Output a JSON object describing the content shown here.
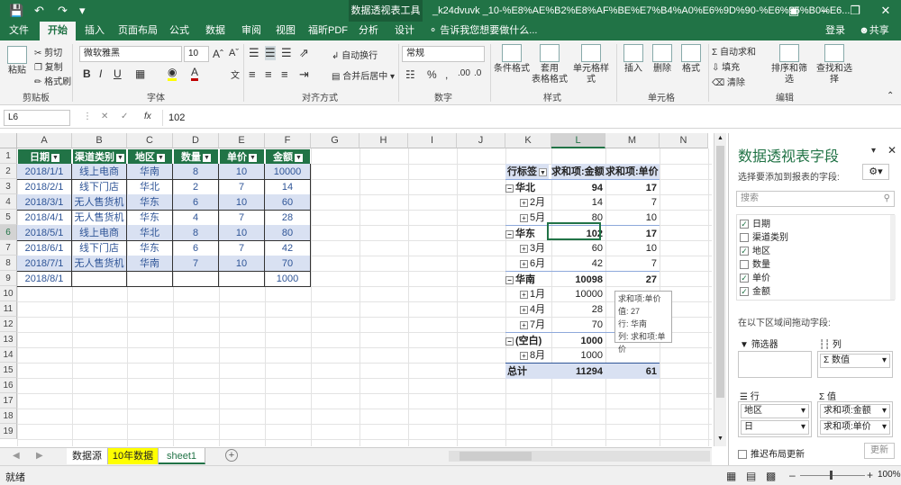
{
  "titlebar": {
    "context_tool": "数据透视表工具",
    "doc_name": "_k24dvuvk _10-%E8%AE%B2%E8%AF%BE%E7%B4%A0%E6%9D%90-%E6%95%B0%E6..."
  },
  "tabs": [
    "文件",
    "开始",
    "插入",
    "页面布局",
    "公式",
    "数据",
    "审阅",
    "视图",
    "福昕PDF",
    "分析",
    "设计"
  ],
  "tell_me": "告诉我您想要做什么...",
  "login": "登录",
  "share": "共享",
  "ribbon": {
    "paste": "粘贴",
    "cut": "剪切",
    "copy": "复制",
    "format_painter": "格式刷",
    "clipboard_label": "剪贴板",
    "font_name": "微软雅黑",
    "font_size": "10",
    "font_label": "字体",
    "wrap": "自动换行",
    "merge": "合并后居中",
    "align_label": "对齐方式",
    "number_format": "常规",
    "number_label": "数字",
    "cond_format": "条件格式",
    "table_format": "套用\n表格格式",
    "cell_style": "单元格样式",
    "style_label": "样式",
    "insert": "插入",
    "delete": "删除",
    "format": "格式",
    "cells_label": "单元格",
    "autosum": "自动求和",
    "fill": "填充",
    "clear": "清除",
    "sort_filter": "排序和筛选",
    "find_select": "查找和选择",
    "edit_label": "编辑"
  },
  "formula_bar": {
    "name_box": "L6",
    "value": "102"
  },
  "columns": [
    "A",
    "B",
    "C",
    "D",
    "E",
    "F",
    "G",
    "H",
    "I",
    "J",
    "K",
    "L",
    "M",
    "N"
  ],
  "rows": [
    "1",
    "2",
    "3",
    "4",
    "5",
    "6",
    "7",
    "8",
    "9",
    "10",
    "11",
    "12",
    "13",
    "14",
    "15",
    "16",
    "17",
    "18",
    "19"
  ],
  "table": {
    "headers": [
      "日期",
      "渠道类别",
      "地区",
      "数量",
      "单价",
      "金额"
    ],
    "rows": [
      [
        "2018/1/1",
        "线上电商",
        "华南",
        "8",
        "10",
        "10000"
      ],
      [
        "2018/2/1",
        "线下门店",
        "华北",
        "2",
        "7",
        "14"
      ],
      [
        "2018/3/1",
        "无人售货机",
        "华东",
        "6",
        "10",
        "60"
      ],
      [
        "2018/4/1",
        "无人售货机",
        "华东",
        "4",
        "7",
        "28"
      ],
      [
        "2018/5/1",
        "线上电商",
        "华北",
        "8",
        "10",
        "80"
      ],
      [
        "2018/6/1",
        "线下门店",
        "华东",
        "6",
        "7",
        "42"
      ],
      [
        "2018/7/1",
        "无人售货机",
        "华南",
        "7",
        "10",
        "70"
      ],
      [
        "2018/8/1",
        "",
        "",
        "",
        "",
        "1000"
      ]
    ]
  },
  "pivot": {
    "headers": [
      "行标签",
      "求和项:金额",
      "求和项:单价"
    ],
    "rows": [
      {
        "label": "华北",
        "sum": "94",
        "price": "17",
        "level": 0
      },
      {
        "label": "2月",
        "sum": "14",
        "price": "7",
        "level": 1
      },
      {
        "label": "5月",
        "sum": "80",
        "price": "10",
        "level": 1
      },
      {
        "label": "华东",
        "sum": "102",
        "price": "17",
        "level": 0
      },
      {
        "label": "3月",
        "sum": "60",
        "price": "10",
        "level": 1
      },
      {
        "label": "6月",
        "sum": "42",
        "price": "7",
        "level": 1
      },
      {
        "label": "华南",
        "sum": "10098",
        "price": "27",
        "level": 0
      },
      {
        "label": "1月",
        "sum": "10000",
        "price": "",
        "level": 1
      },
      {
        "label": "4月",
        "sum": "28",
        "price": "",
        "level": 1
      },
      {
        "label": "7月",
        "sum": "70",
        "price": "",
        "level": 1
      },
      {
        "label": "(空白)",
        "sum": "1000",
        "price": "",
        "level": 0
      },
      {
        "label": "8月",
        "sum": "1000",
        "price": "",
        "level": 1
      }
    ],
    "total": {
      "label": "总计",
      "sum": "11294",
      "price": "61"
    }
  },
  "tooltip": {
    "title": "求和项:单价",
    "value": "值: 27",
    "row": "行: 华南",
    "col": "列: 求和项:单价"
  },
  "sheet_tabs": [
    "数据源",
    "10年数据",
    "sheet1"
  ],
  "status": {
    "ready": "就绪",
    "zoom": "100%"
  },
  "pane": {
    "title": "数据透视表字段",
    "subtitle": "选择要添加到报表的字段:",
    "search": "搜索",
    "fields": [
      {
        "name": "日期",
        "checked": true
      },
      {
        "name": "渠道类别",
        "checked": false
      },
      {
        "name": "地区",
        "checked": true
      },
      {
        "name": "数量",
        "checked": false
      },
      {
        "name": "单价",
        "checked": true
      },
      {
        "name": "金额",
        "checked": true
      }
    ],
    "drag_label": "在以下区域间拖动字段:",
    "filter_label": "筛选器",
    "col_label": "列",
    "row_label": "行",
    "value_label": "值",
    "col_item": "Σ 数值",
    "row_item": "地区",
    "row_item2": "日",
    "val_item1": "求和项:金额",
    "val_item2": "求和项:单价",
    "defer": "推迟布局更新",
    "update": "更新"
  }
}
